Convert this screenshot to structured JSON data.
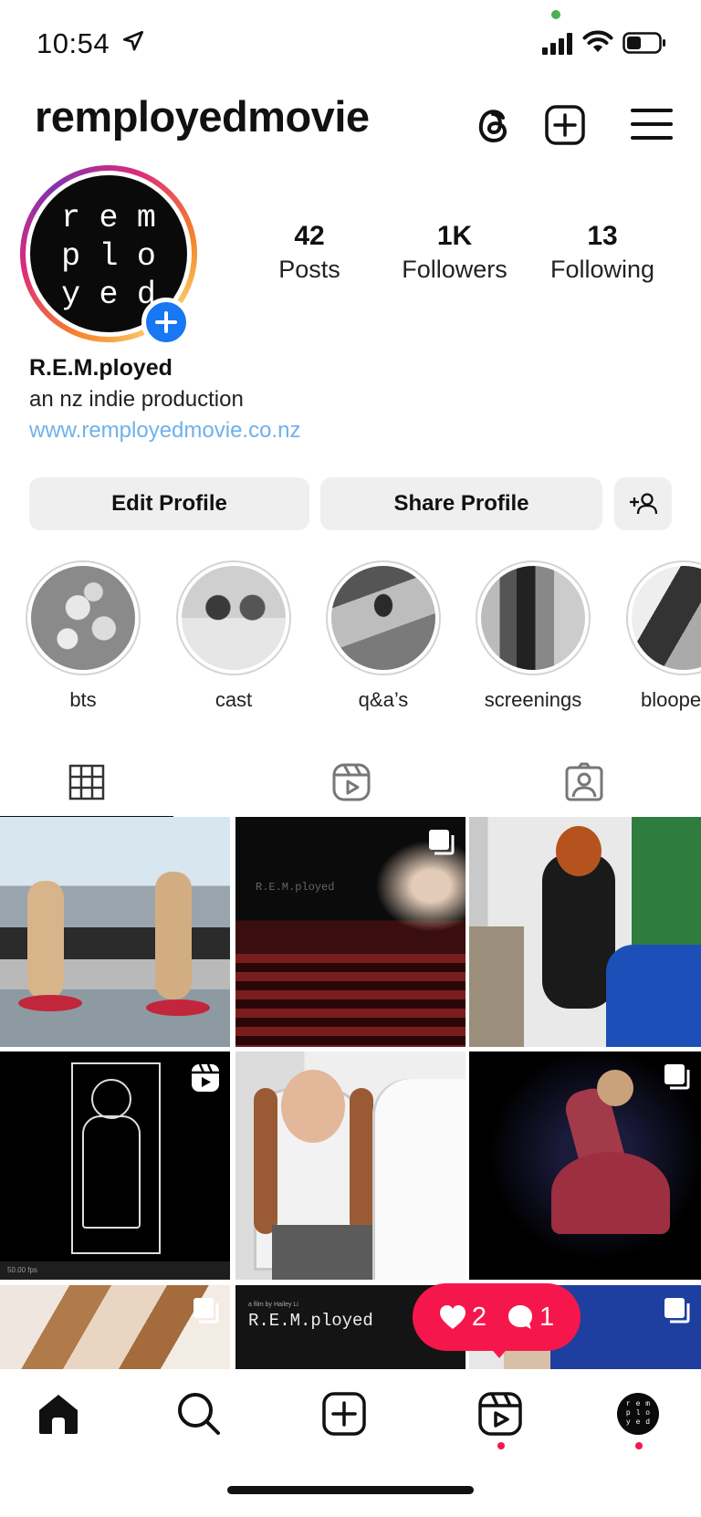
{
  "status_bar": {
    "time": "10:54"
  },
  "header": {
    "username": "remployedmovie"
  },
  "avatar": {
    "letters": [
      "r",
      "e",
      "m",
      "p",
      "l",
      "o",
      "y",
      "e",
      "d"
    ]
  },
  "stats": [
    {
      "value": "42",
      "label": "Posts"
    },
    {
      "value": "1K",
      "label": "Followers"
    },
    {
      "value": "13",
      "label": "Following"
    }
  ],
  "bio": {
    "name": "R.E.M.ployed",
    "text": "an nz indie production",
    "link": "www.remployedmovie.co.nz"
  },
  "buttons": {
    "edit": "Edit Profile",
    "share": "Share Profile"
  },
  "highlights": [
    {
      "label": "bts"
    },
    {
      "label": "cast"
    },
    {
      "label": "q&a’s"
    },
    {
      "label": "screenings"
    },
    {
      "label": "bloope"
    }
  ],
  "posts": {
    "post_2_text": "R.E.M.ployed",
    "post_8_small": "a film by Hailey Li",
    "post_8_title": "R.E.M.ployed",
    "post_4_bar": "50.00 fps"
  },
  "notifications": {
    "likes": "2",
    "comments": "1"
  },
  "colors": {
    "accent_blue": "#1877f2",
    "link": "#6fb1ec",
    "notif": "#f5174b"
  }
}
